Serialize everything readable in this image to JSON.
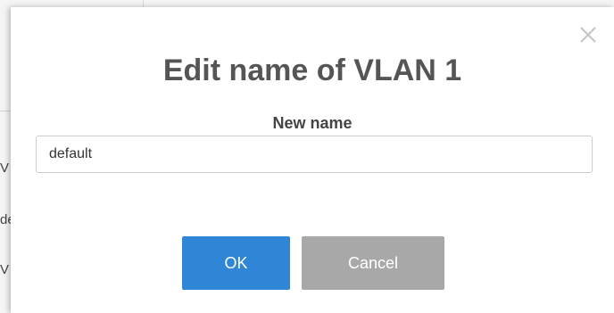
{
  "background": {
    "fragments": [
      "V",
      "de",
      "V"
    ]
  },
  "dialog": {
    "title": "Edit name of VLAN 1",
    "field_label": "New name",
    "name_value": "default",
    "ok_label": "OK",
    "cancel_label": "Cancel",
    "close_icon": "close-icon"
  },
  "colors": {
    "primary": "#2f86d6",
    "secondary": "#a8a8a8",
    "title": "#555555"
  }
}
